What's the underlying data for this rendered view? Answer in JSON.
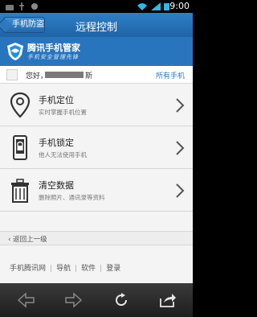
{
  "status_bar": {
    "time": "9:00"
  },
  "header": {
    "back_label": "手机防盗",
    "title": "远程控制"
  },
  "brand": {
    "title": "腾讯手机管家",
    "slogan": "手机安全管理先锋"
  },
  "user": {
    "greeting": "您好，",
    "name_tail": "斯",
    "all_phones": "所有手机"
  },
  "features": [
    {
      "title": "手机定位",
      "desc": "实时掌握手机位置",
      "icon": "location-pin-icon"
    },
    {
      "title": "手机锁定",
      "desc": "他人无法使用手机",
      "icon": "phone-lock-icon"
    },
    {
      "title": "清空数据",
      "desc": "删除照片、通讯录等资料",
      "icon": "trash-icon"
    }
  ],
  "backup_link": "返回上一级",
  "footer_links": [
    "手机腾讯网",
    "导航",
    "软件",
    "登录"
  ],
  "browser_nav": [
    "back-arrow-icon",
    "forward-arrow-icon",
    "refresh-icon",
    "share-icon"
  ]
}
